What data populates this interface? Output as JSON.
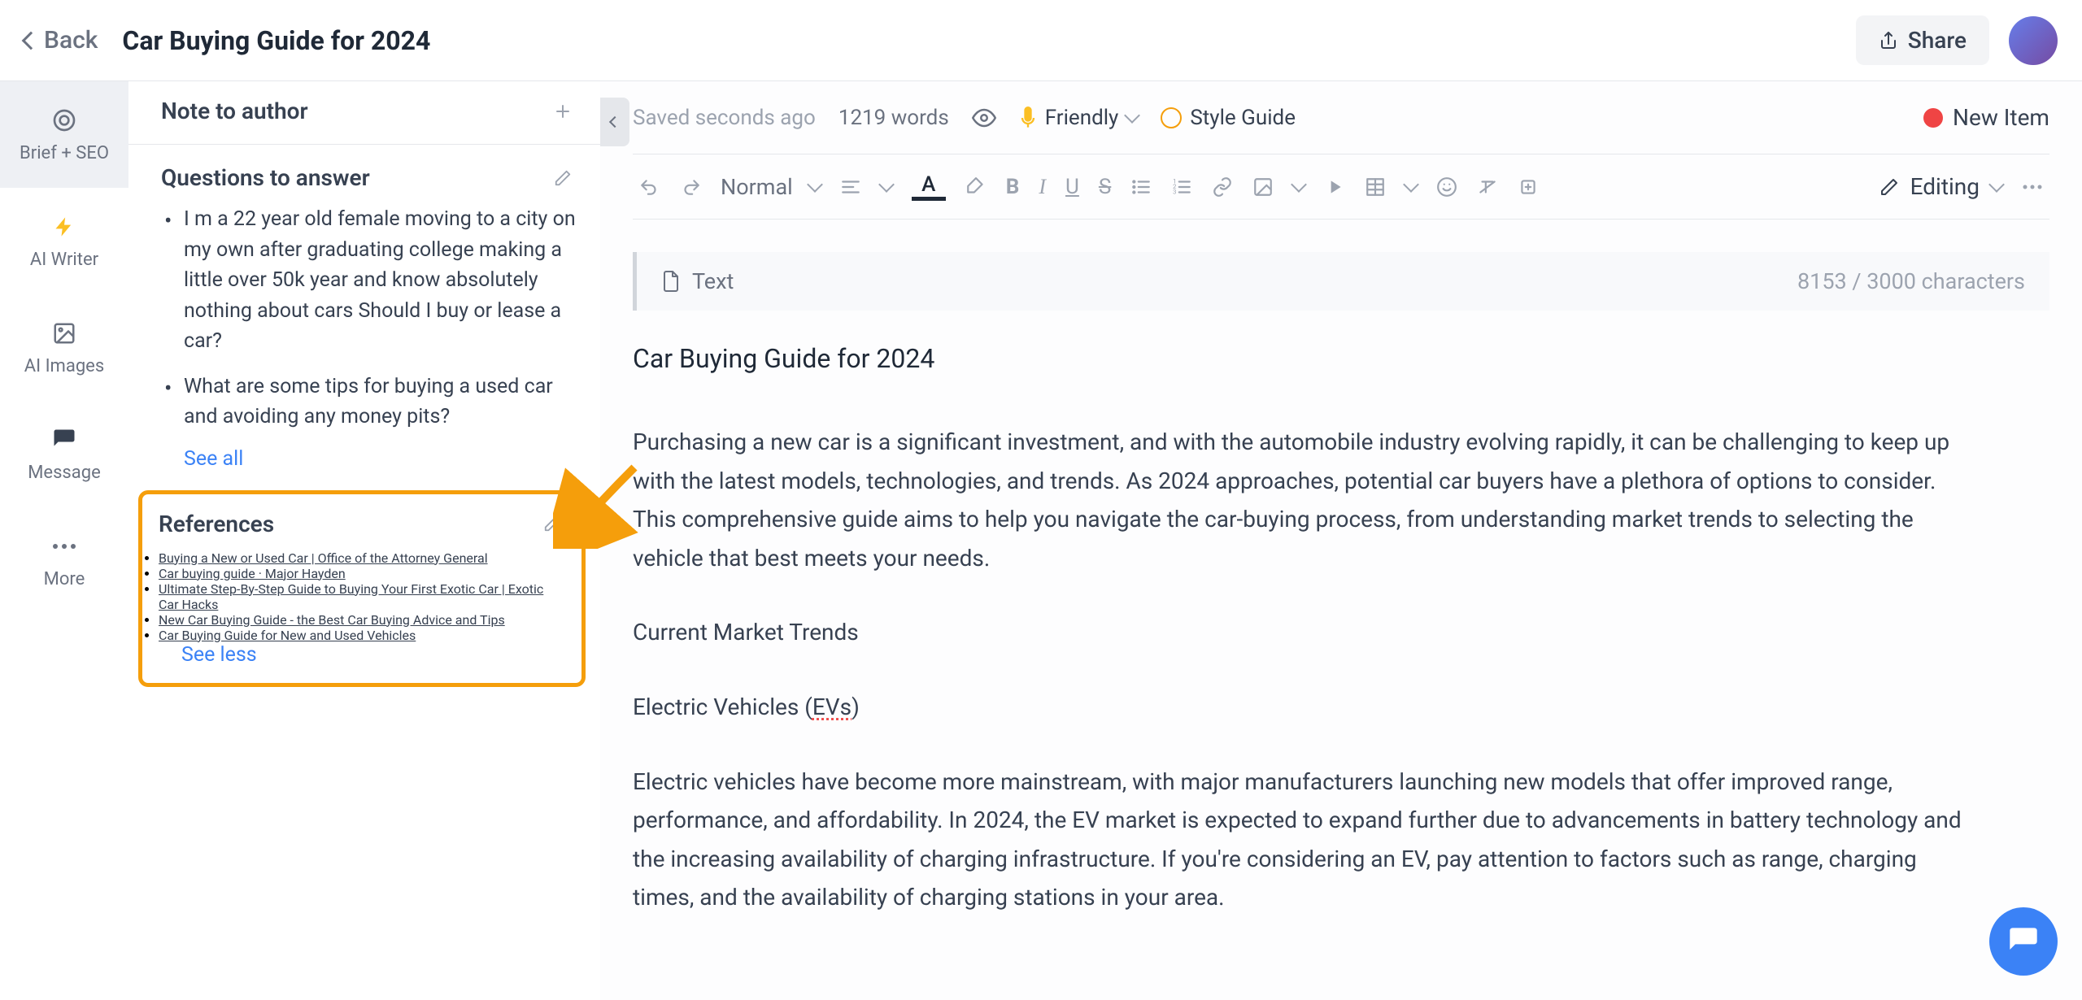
{
  "header": {
    "back_label": "Back",
    "title": "Car Buying Guide for 2024",
    "share_label": "Share"
  },
  "nav": {
    "brief": "Brief + SEO",
    "ai_writer": "AI Writer",
    "ai_images": "AI Images",
    "message": "Message",
    "more": "More"
  },
  "sidebar": {
    "note_title": "Note to author",
    "questions_title": "Questions to answer",
    "questions": [
      "I m a 22 year old female moving to a city on my own after graduating college making a little over 50k year and know absolutely nothing about cars Should I buy or lease a car?",
      "What are some tips for buying a used car and avoiding any money pits?"
    ],
    "see_all": "See all",
    "references_title": "References",
    "references": [
      "Buying a New or Used Car | Office of the Attorney General",
      "Car buying guide · Major Hayden",
      "Ultimate Step-By-Step Guide to Buying Your First Exotic Car | Exotic Car Hacks",
      "New Car Buying Guide - the Best Car Buying Advice and Tips",
      "Car Buying Guide for New and Used Vehicles"
    ],
    "see_less": "See less"
  },
  "editor": {
    "saved_label": "Saved seconds ago",
    "word_count": "1219 words",
    "tone_label": "Friendly",
    "style_guide_label": "Style Guide",
    "new_item_label": "New Item",
    "para_style": "Normal",
    "editing_mode": "Editing",
    "text_callout_label": "Text",
    "char_count": "8153 / 3000 characters"
  },
  "document": {
    "title": "Car Buying Guide for 2024",
    "p1": "Purchasing a new car is a significant investment, and with the automobile industry evolving rapidly, it can be challenging to keep up with the latest models, technologies, and trends. As 2024 approaches, potential car buyers have a plethora of options to consider. This comprehensive guide aims to help you navigate the car-buying process, from understanding market trends to selecting the vehicle that best meets your needs.",
    "h2_1": "Current Market Trends",
    "h3_1_pre": "Electric Vehicles (",
    "h3_1_ev": "EVs",
    "h3_1_post": ")",
    "p2": "Electric vehicles have become more mainstream, with major manufacturers launching new models that offer improved range, performance, and affordability. In 2024, the EV market is expected to expand further due to advancements in battery technology and the increasing availability of charging infrastructure. If you're considering an EV, pay attention to factors such as range, charging times, and the availability of charging stations in your area."
  }
}
